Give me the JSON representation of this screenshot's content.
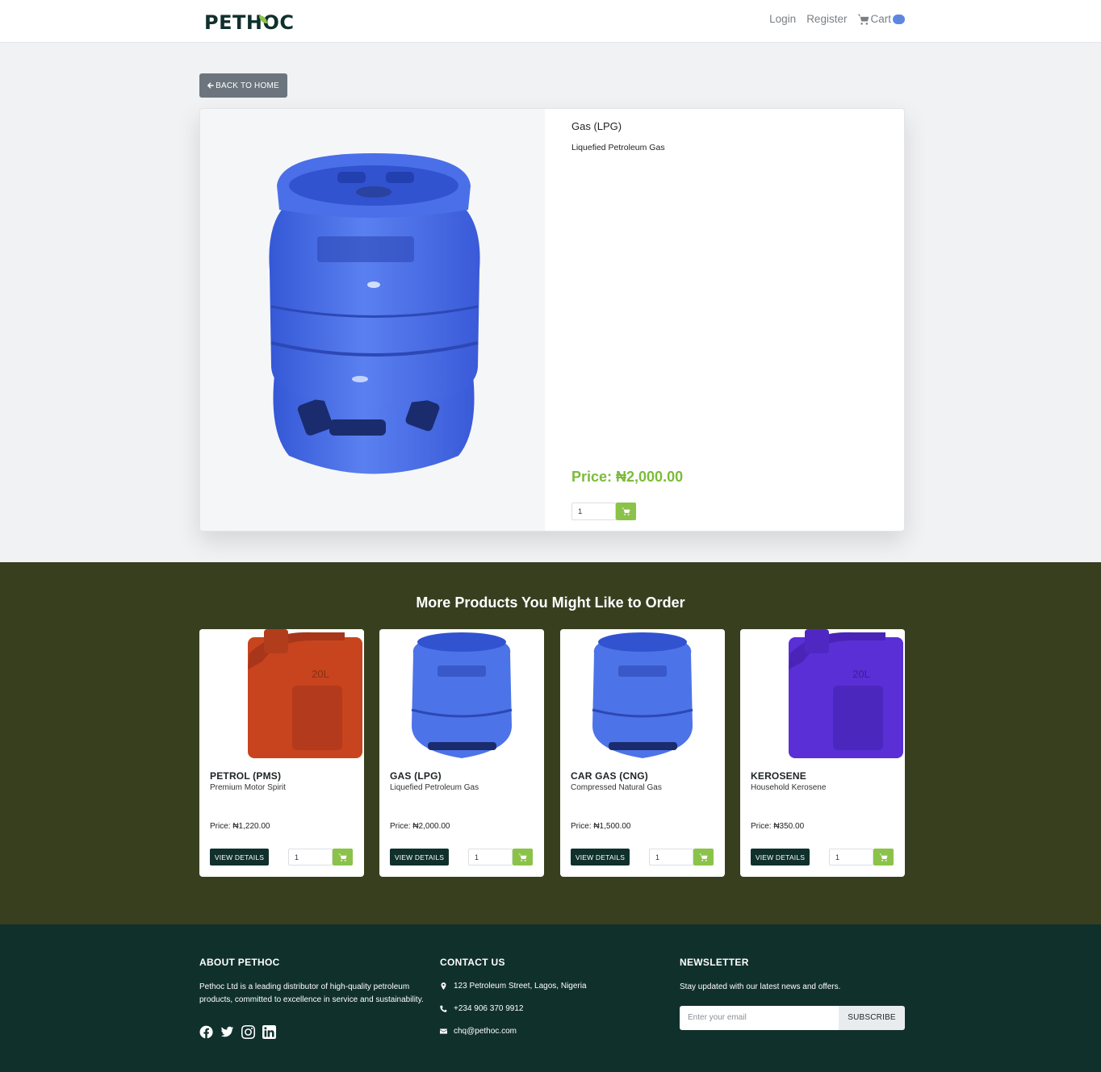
{
  "navbar": {
    "logo": "PETHOC",
    "login": "Login",
    "register": "Register",
    "cart_label": "Cart",
    "cart_count": "0"
  },
  "back_button": "BACK TO HOME",
  "product": {
    "title": "Gas (LPG)",
    "description": "Liquefied Petroleum Gas",
    "price": "Price: ₦2,000.00",
    "quantity": "1",
    "image_color": "#4d73e8"
  },
  "more": {
    "title": "More Products You Might Like to Order",
    "items": [
      {
        "name": "PETROL (PMS)",
        "desc": "Premium Motor Spirit",
        "price": "Price: ₦1,220.00",
        "btn": "VIEW DETAILS",
        "qty": "1",
        "image": "jerrycan",
        "color": "#c7441e"
      },
      {
        "name": "GAS (LPG)",
        "desc": "Liquefied Petroleum Gas",
        "price": "Price: ₦2,000.00",
        "btn": "VIEW DETAILS",
        "qty": "1",
        "image": "gas-cylinder",
        "color": "#4d73e8"
      },
      {
        "name": "CAR GAS (CNG)",
        "desc": "Compressed Natural Gas",
        "price": "Price: ₦1,500.00",
        "btn": "VIEW DETAILS",
        "qty": "1",
        "image": "gas-cylinder",
        "color": "#4d73e8"
      },
      {
        "name": "KEROSENE",
        "desc": "Household Kerosene",
        "price": "Price: ₦350.00",
        "btn": "VIEW DETAILS",
        "qty": "1",
        "image": "jerrycan",
        "color": "#5a2fd6"
      }
    ]
  },
  "footer": {
    "about": {
      "title": "ABOUT PETHOC",
      "text": "Pethoc Ltd is a leading distributor of high-quality petroleum products, committed to excellence in service and sustainability."
    },
    "contact": {
      "title": "CONTACT US",
      "address": "123 Petroleum Street, Lagos, Nigeria",
      "phone": "+234 906 370 9912",
      "email": "chq@pethoc.com"
    },
    "newsletter": {
      "title": "NEWSLETTER",
      "text": "Stay updated with our latest news and offers.",
      "placeholder": "Enter your email",
      "button": "SUBSCRIBE"
    }
  },
  "colors": {
    "accent_green": "#8bc34a",
    "dark_green": "#10302c",
    "olive": "#383f1f"
  }
}
